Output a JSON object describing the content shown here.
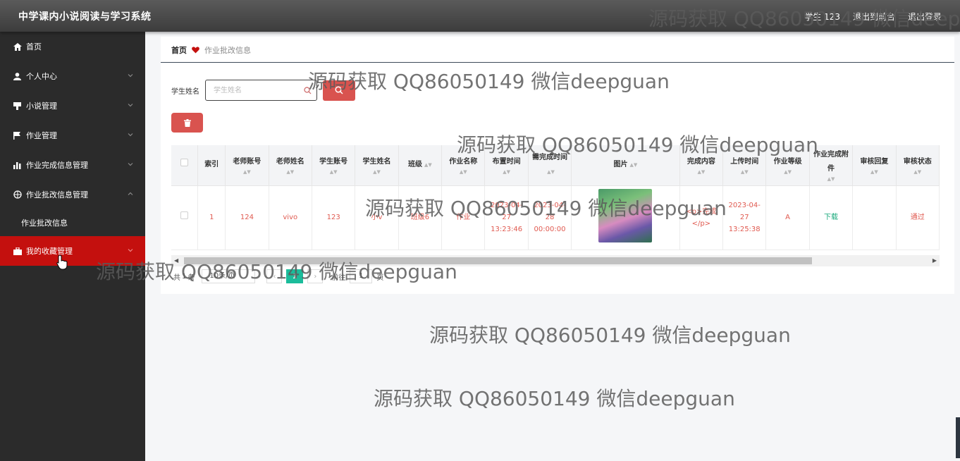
{
  "app": {
    "title": "中学课内小说阅读与学习系统"
  },
  "topbar": {
    "user": "学生 123",
    "frontend_link": "退出到前台",
    "logout_link": "退出登录"
  },
  "sidebar": {
    "items": [
      {
        "label": "首页",
        "icon": "home-icon"
      },
      {
        "label": "个人中心",
        "icon": "user-icon"
      },
      {
        "label": "小说管理",
        "icon": "book-icon"
      },
      {
        "label": "作业管理",
        "icon": "flag-icon"
      },
      {
        "label": "作业完成信息管理",
        "icon": "bar-chart-icon"
      },
      {
        "label": "作业批改信息管理",
        "icon": "compass-icon"
      },
      {
        "label": "我的收藏管理",
        "icon": "briefcase-icon"
      }
    ],
    "submenu": {
      "label": "作业批改信息"
    }
  },
  "breadcrumb": {
    "home": "首页",
    "current": "作业批改信息"
  },
  "search": {
    "label": "学生姓名",
    "placeholder": "学生姓名",
    "value": ""
  },
  "table": {
    "columns": [
      "索引",
      "老师账号",
      "老师姓名",
      "学生账号",
      "学生姓名",
      "班级",
      "作业名称",
      "布置时间",
      "需完成时间",
      "图片",
      "完成内容",
      "上传时间",
      "作业等级",
      "作业完成附件",
      "审核回复",
      "审核状态"
    ],
    "rows": [
      {
        "index": "1",
        "teacher_account": "124",
        "teacher_name": "vivo",
        "student_account": "123",
        "student_name": "小v",
        "class": "班级6",
        "homework_name": "作业",
        "assign_time": "2023-04-27 13:23:46",
        "due_time": "2023-04-28 00:00:00",
        "content": "<p>完成</p>",
        "upload_time": "2023-04-27 13:25:38",
        "grade": "A",
        "attachment": "下载",
        "review_reply": "",
        "review_status": "通过"
      }
    ]
  },
  "pagination": {
    "total_prefix": "共",
    "total": "1",
    "total_suffix": "条",
    "page_size": "10条/页",
    "current_page": "1",
    "goto_prefix": "前往",
    "goto_value": "1",
    "goto_suffix": "页"
  },
  "watermark": "源码获取 QQ86050149 微信deepguan",
  "colors": {
    "topbar": "#4a4a4a",
    "sidebar": "#2b2b2b",
    "active_menu": "#c4100e",
    "danger": "#d9534f",
    "accent_green": "#1bbc9b",
    "table_text": "#e05a50"
  }
}
